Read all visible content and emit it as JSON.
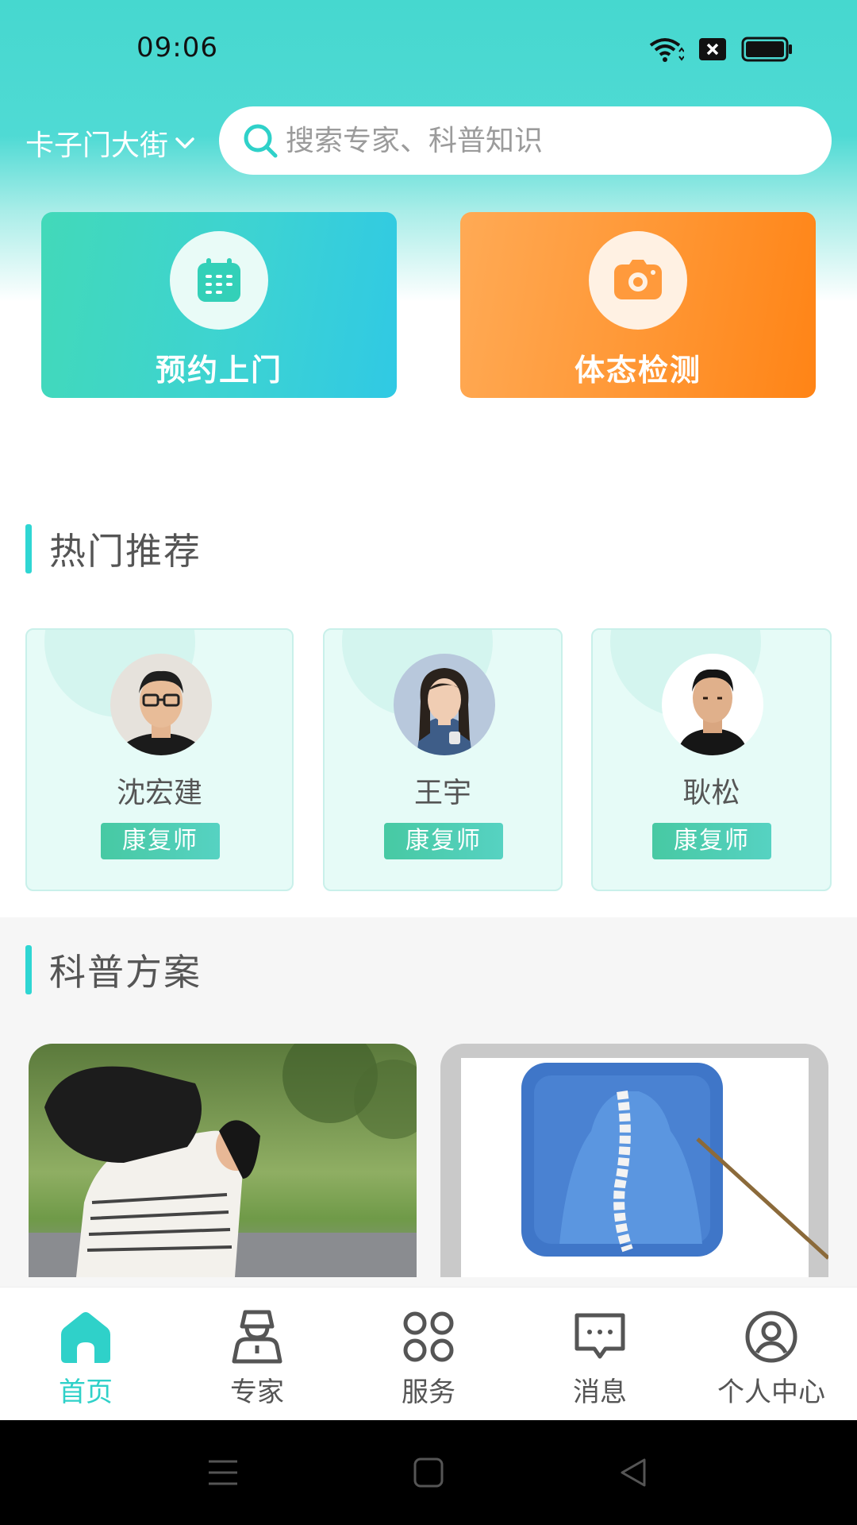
{
  "status_bar": {
    "time": "09:06"
  },
  "header": {
    "location": "卡子门大街",
    "search_placeholder": "搜索专家、科普知识"
  },
  "quick_actions": [
    {
      "label": "预约上门",
      "icon": "calendar-icon"
    },
    {
      "label": "体态检测",
      "icon": "camera-icon"
    }
  ],
  "hot_section": {
    "title": "热门推荐",
    "experts": [
      {
        "name": "沈宏建",
        "tag": "康复师"
      },
      {
        "name": "王宇",
        "tag": "康复师"
      },
      {
        "name": "耿松",
        "tag": "康复师"
      }
    ]
  },
  "science_section": {
    "title": "科普方案"
  },
  "tabbar": {
    "items": [
      {
        "label": "首页",
        "icon": "home-icon",
        "active": true
      },
      {
        "label": "专家",
        "icon": "expert-icon",
        "active": false
      },
      {
        "label": "服务",
        "icon": "grid-icon",
        "active": false
      },
      {
        "label": "消息",
        "icon": "message-icon",
        "active": false
      },
      {
        "label": "个人中心",
        "icon": "profile-icon",
        "active": false
      }
    ]
  },
  "colors": {
    "accent": "#2fd1c9",
    "appointment_card": "#3dd3d2",
    "posture_card": "#ff9633"
  }
}
